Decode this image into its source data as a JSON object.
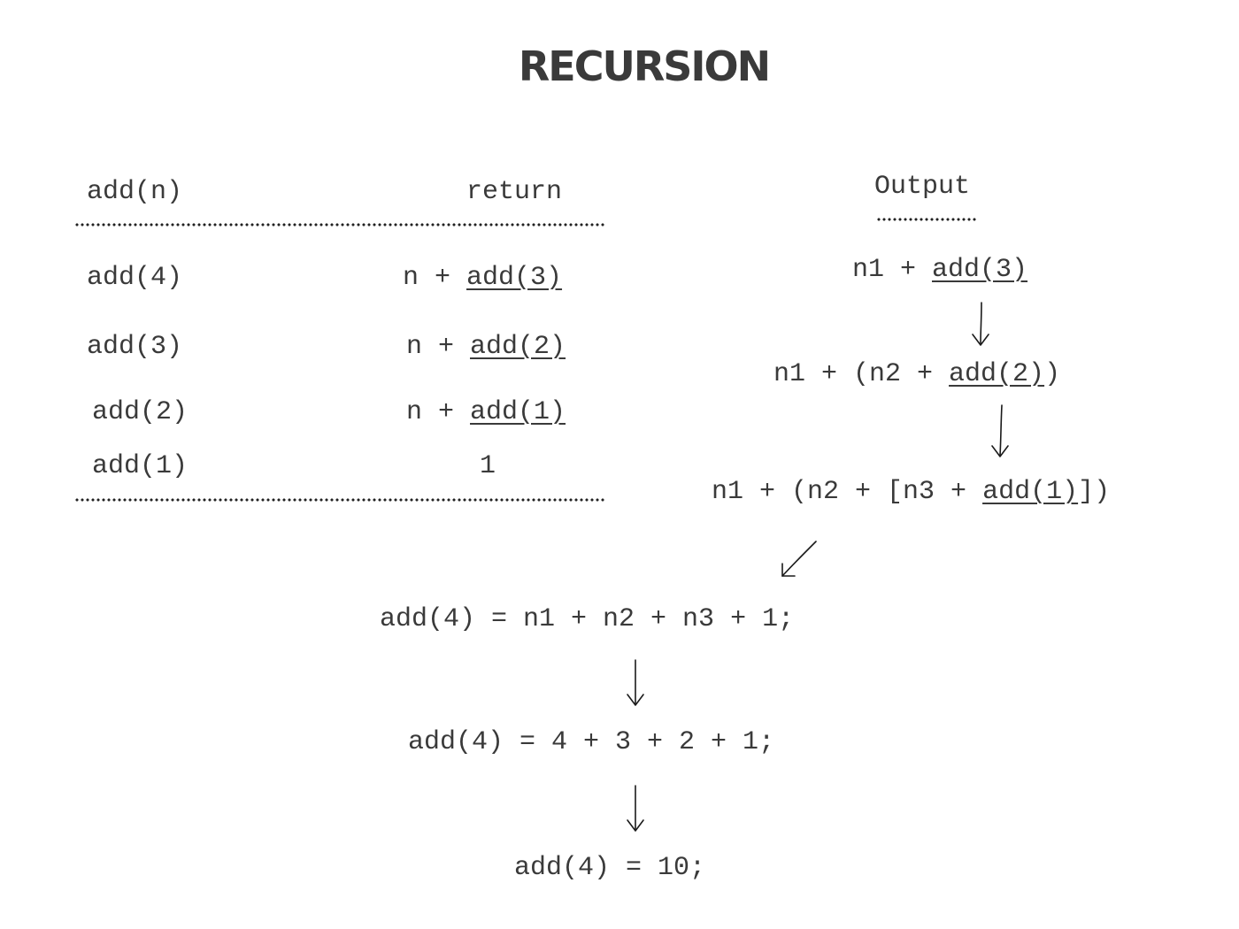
{
  "title": "RECURSION",
  "table": {
    "headers": {
      "call": "add(n)",
      "ret": "return"
    },
    "rows": [
      {
        "call": "add(4)",
        "ret_prefix": "n + ",
        "ret_call": "add(3)"
      },
      {
        "call": "add(3)",
        "ret_prefix": "n + ",
        "ret_call": "add(2)"
      },
      {
        "call": "add(2)",
        "ret_prefix": "n + ",
        "ret_call": "add(1)"
      },
      {
        "call": "add(1)",
        "ret_prefix": "1",
        "ret_call": ""
      }
    ]
  },
  "output": {
    "header": "Output",
    "steps": [
      {
        "pre": "n1 + ",
        "call": "add(3)",
        "post": ""
      },
      {
        "pre": "n1 + (n2 + ",
        "call": "add(2)",
        "post": ")"
      },
      {
        "pre": "n1 + (n2 + [n3 + ",
        "call": "add(1)",
        "post": "])"
      }
    ]
  },
  "result_lines": [
    "add(4) = n1 + n2 + n3 + 1;",
    "add(4) = 4 + 3 + 2 + 1;",
    "add(4) = 10;"
  ]
}
